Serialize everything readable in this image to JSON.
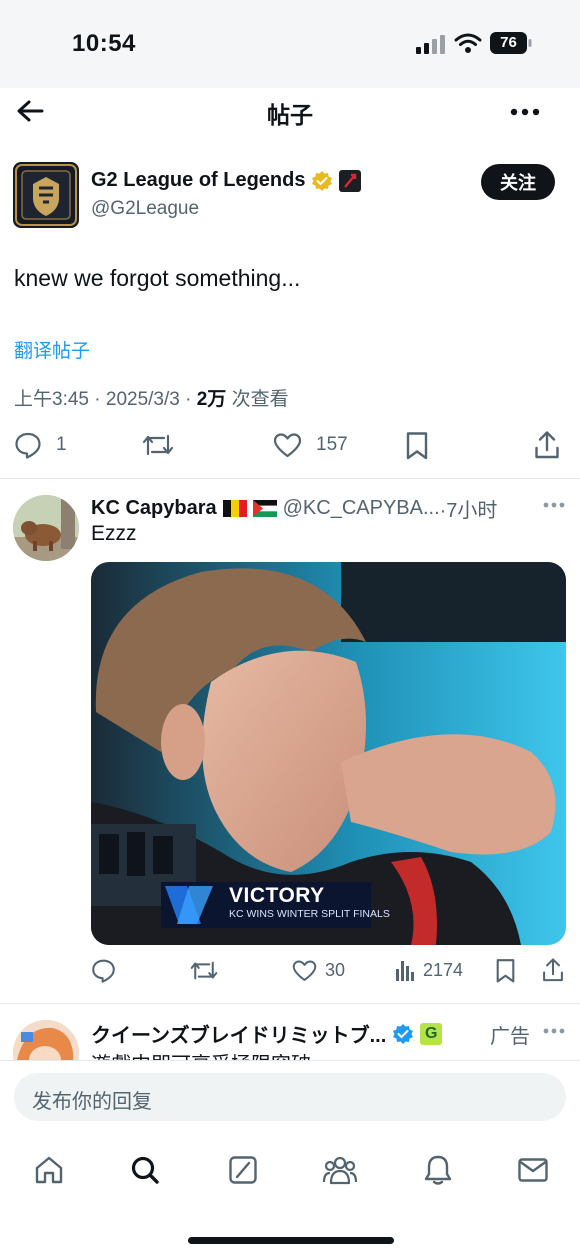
{
  "status_bar": {
    "time": "10:54",
    "battery": "76"
  },
  "header": {
    "title": "帖子"
  },
  "post": {
    "author_name": "G2 League of Legends",
    "author_handle": "@G2League",
    "follow_label": "关注",
    "text": "knew we forgot something...",
    "translate_label": "翻译帖子",
    "time": "上午3:45",
    "date": "2025/3/3",
    "views_count": "2万",
    "views_label": "次查看",
    "replies": "1",
    "likes": "157"
  },
  "reply": {
    "author_name": "KC Capybara",
    "author_handle": "@KC_CAPYBA...",
    "time": "·7小时",
    "text": "Ezzz",
    "media": {
      "overlay_title": "VICTORY",
      "overlay_sub": "KC WINS WINTER SPLIT FINALS"
    },
    "likes": "30",
    "views": "2174"
  },
  "ad": {
    "author_name": "クイーンズブレイドリミットブ...",
    "badge": "G",
    "ad_label": "广告",
    "text": "遊戲中即可享受極限突破"
  },
  "compose": {
    "placeholder": "发布你的回复"
  },
  "tabs": [
    "home",
    "search",
    "grok",
    "communities",
    "notifications",
    "messages"
  ],
  "colors": {
    "accent": "#1d9bf0",
    "verified_gold": "#e8b923",
    "text": "#0f1419",
    "secondary": "#536471"
  }
}
